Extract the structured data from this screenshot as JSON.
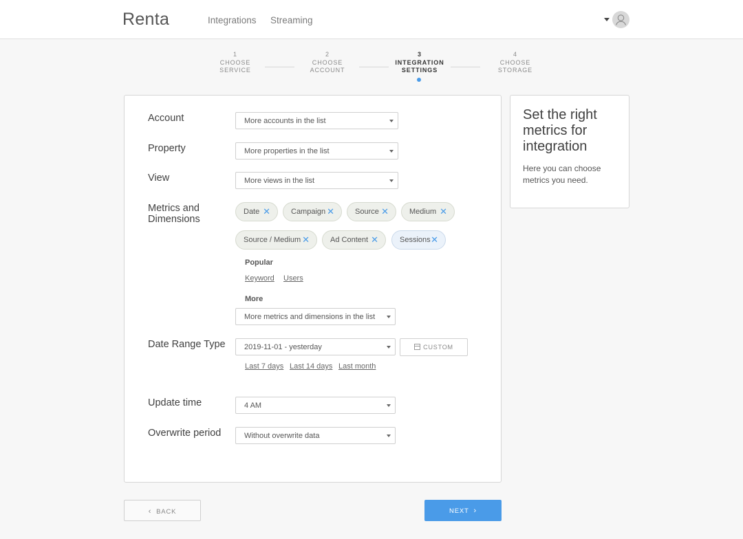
{
  "header": {
    "logo": "Renta",
    "nav": [
      "Integrations",
      "Streaming"
    ]
  },
  "stepper": {
    "steps": [
      {
        "number": "1",
        "line1": "CHOOSE",
        "line2": "SERVICE"
      },
      {
        "number": "2",
        "line1": "CHOOSE",
        "line2": "ACCOUNT"
      },
      {
        "number": "3",
        "line1": "INTEGRATION",
        "line2": "SETTINGS"
      },
      {
        "number": "4",
        "line1": "CHOOSE",
        "line2": "STORAGE"
      }
    ],
    "active_step": 3
  },
  "form": {
    "account": {
      "label": "Account",
      "value": "More accounts in the list"
    },
    "property": {
      "label": "Property",
      "value": "More properties in the list"
    },
    "view": {
      "label": "View",
      "value": "More views in the list"
    },
    "metrics": {
      "label_line1": "Metrics and",
      "label_line2": "Dimensions",
      "chips": [
        "Date",
        "Campaign",
        "Source",
        "Medium",
        "Source / Medium",
        "Ad Content",
        "Sessions"
      ],
      "popular_heading": "Popular",
      "popular_links": [
        "Keyword",
        "Users"
      ],
      "more_heading": "More",
      "more_select": "More metrics and dimensions in the list"
    },
    "date_range": {
      "label": "Date Range Type",
      "value": "2019-11-01 - yesterday",
      "custom_label": "CUSTOM",
      "quick_links": [
        "Last 7 days",
        "Last 14 days",
        "Last month"
      ]
    },
    "update_time": {
      "label": "Update time",
      "value": "4 AM"
    },
    "overwrite": {
      "label": "Overwrite period",
      "value": "Without overwrite data"
    }
  },
  "sidebar": {
    "title": "Set the right metrics for integration",
    "text": "Here you can choose metrics you need."
  },
  "footer": {
    "back_label": "BACK",
    "next_label": "NEXT"
  },
  "colors": {
    "accent": "#4a9be8",
    "chip_bg": "#eef0eb",
    "chip_selected_bg": "#ebf2fa",
    "page_bg": "#f7f7f7"
  }
}
